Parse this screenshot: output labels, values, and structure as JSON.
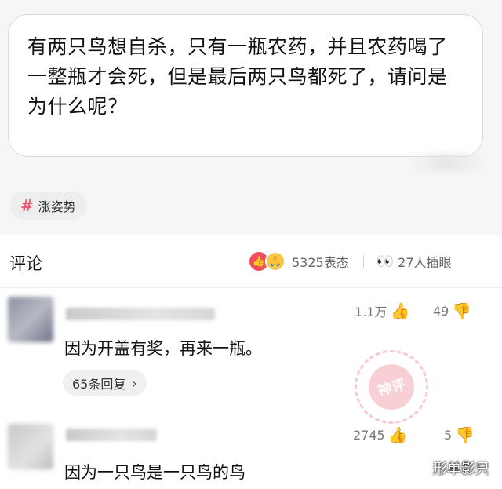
{
  "question": {
    "text": "有两只鸟想自杀，只有一瓶农药，并且农药喝了一整瓶才会死，但是最后两只鸟都死了，请问是为什么呢？"
  },
  "tag": {
    "hash": "#",
    "label": "涨姿势"
  },
  "comments_header": {
    "title": "评论",
    "reaction_count": "5325表态",
    "watching_count": "27人插眼",
    "like_emoji": "👍",
    "hand_emoji": "🙏",
    "eyes_emoji": "👀"
  },
  "comments": [
    {
      "like_count": "1.1万",
      "dislike_count": "49",
      "text": "因为开盖有奖，再来一瓶。",
      "reply_label": "65条回复",
      "reply_chevron": "›",
      "stamp": "神评"
    },
    {
      "like_count": "2745",
      "dislike_count": "5",
      "text": "因为一只鸟是一只鸟的鸟"
    }
  ],
  "icons": {
    "thumb_up": "👍",
    "thumb_down": "👎"
  },
  "watermark": "形单影只",
  "colors": {
    "accent": "#ef5b73",
    "page_bg": "#f6f6f6",
    "card_bg": "#ffffff"
  }
}
